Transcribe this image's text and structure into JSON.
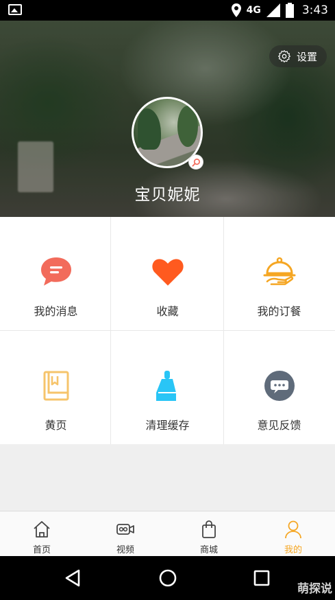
{
  "status_bar": {
    "network": "4G",
    "time": "3:43"
  },
  "profile": {
    "settings_label": "设置",
    "username": "宝贝妮妮"
  },
  "menu": {
    "items": [
      {
        "label": "我的消息",
        "icon": "message-icon",
        "color": "#f26b5b"
      },
      {
        "label": "收藏",
        "icon": "heart-icon",
        "color": "#ff5a1f"
      },
      {
        "label": "我的订餐",
        "icon": "food-tray-icon",
        "color": "#f5a623"
      },
      {
        "label": "黄页",
        "icon": "yellow-pages-icon",
        "color": "#f6c46b"
      },
      {
        "label": "清理缓存",
        "icon": "broom-icon",
        "color": "#29c5f6"
      },
      {
        "label": "意见反馈",
        "icon": "feedback-icon",
        "color": "#5f6b7a"
      }
    ]
  },
  "tabbar": {
    "tabs": [
      {
        "label": "首页",
        "icon": "home-icon"
      },
      {
        "label": "视频",
        "icon": "video-icon"
      },
      {
        "label": "商城",
        "icon": "shopping-bag-icon"
      },
      {
        "label": "我的",
        "icon": "user-icon",
        "active": true
      }
    ],
    "active_color": "#f5a623"
  },
  "watermark": "萌探说"
}
